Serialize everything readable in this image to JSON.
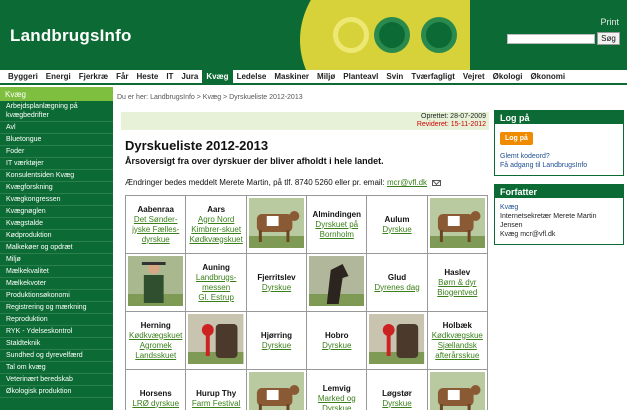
{
  "header": {
    "logo": "LandbrugsInfo",
    "print": "Print",
    "search_placeholder": "",
    "search_button": "Søg"
  },
  "topnav": [
    "Byggeri",
    "Energi",
    "Fjerkræ",
    "Får",
    "Heste",
    "IT",
    "Jura",
    "Kvæg",
    "Ledelse",
    "Maskiner",
    "Miljø",
    "Planteavl",
    "Svin",
    "Tværfagligt",
    "Vejret",
    "Økologi",
    "Økonomi"
  ],
  "topnav_active": "Kvæg",
  "sidebar": {
    "head": "Kvæg",
    "items": [
      "Arbejdsplanlægning på kvægbedrifter",
      "Avl",
      "Bluetongue",
      "Foder",
      "IT værktøjer",
      "Konsulentsiden Kvæg",
      "Kvægforskning",
      "Kvægkongressen",
      "Kvægnøglen",
      "Kvægstalde",
      "Kødproduktion",
      "Malkekøer og opdræt",
      "Miljø",
      "Mælkekvalitet",
      "Mælkekvoter",
      "Produktionsøkonomi",
      "Registrering og mærkning",
      "Reproduktion",
      "RYK - Ydelseskontrol",
      "Staldteknik",
      "Sundhed og dyrevelfærd",
      "Tal om kvæg",
      "Veterinært beredskab",
      "Økologisk produktion"
    ]
  },
  "main": {
    "breadcrumb": "Du er her: LandbrugsInfo > Kvæg > Dyrskueliste 2012-2013",
    "created": "Oprettet: 28-07-2009",
    "revised": "Revideret: 15-11-2012",
    "title": "Dyrskueliste 2012-2013",
    "subtitle": "Årsoversigt fra over dyrskuer der bliver afholdt i hele landet.",
    "changes_text": "Ændringer bedes meddelt Merete Martin, på tlf. 8740 5260 eller pr. email:",
    "changes_email": "mcr@vfl.dk"
  },
  "grid": [
    [
      {
        "city": "Aabenraa",
        "links": [
          "Det Sønder-jyske Fælles-dyrskue"
        ]
      },
      {
        "city": "Aars",
        "links": [
          "Agro Nord",
          "Kimbrer-skuet",
          "Kødkvægskuet"
        ]
      },
      {
        "photo": "cow-photo"
      },
      {
        "city": "Almindingen",
        "links": [
          "Dyrskuet på Bornholm"
        ]
      },
      {
        "city": "Aulum",
        "links": [
          "Dyrskue"
        ]
      },
      {
        "photo": "cow-photo"
      }
    ],
    [
      {
        "photo": "man-photo"
      },
      {
        "city": "Auning",
        "links": [
          "Landbrugs-messen",
          "Gl. Estrup"
        ]
      },
      {
        "city": "Fjerritslev",
        "links": [
          "Dyrskue"
        ]
      },
      {
        "photo": "horse-photo"
      },
      {
        "city": "Glud",
        "links": [
          "Dyrenes dag"
        ]
      },
      {
        "city": "Haslev",
        "links": [
          "Børn & dyr",
          "Biogentved"
        ]
      }
    ],
    [
      {
        "city": "Herning",
        "links": [
          "Kødkvægskuet",
          "Agromek",
          "Landsskuet"
        ]
      },
      {
        "photo": "rosette-photo"
      },
      {
        "city": "Hjørring",
        "links": [
          "Dyrskue"
        ]
      },
      {
        "city": "Hobro",
        "links": [
          "Dyrskue"
        ]
      },
      {
        "photo": "rosette-photo"
      },
      {
        "city": "Holbæk",
        "links": [
          "Kødkvægskue",
          "Sjællandsk afterårsskue"
        ]
      }
    ],
    [
      {
        "city": "Horsens",
        "links": [
          "LRØ dyrskue"
        ]
      },
      {
        "city": "Hurup Thy",
        "links": [
          "Farm Festival"
        ]
      },
      {
        "photo": "cow-photo"
      },
      {
        "city": "Lemvig",
        "links": [
          "Marked og Dyrskue"
        ]
      },
      {
        "city": "Løgstør",
        "links": [
          "Dyrskue"
        ]
      },
      {
        "photo": "cow-photo"
      }
    ]
  ],
  "login_box": {
    "title": "Log på",
    "button": "Log på",
    "forgot": "Glemt kodeord?",
    "access": "Få adgang til LandbrugsInfo"
  },
  "author_box": {
    "title": "Forfatter",
    "section": "Kvæg",
    "role": "Internetsekretær Merete Martin Jensen",
    "contact": "Kvæg mcr@vfl.dk"
  },
  "colors": {
    "brand_green": "#0c6b34",
    "accent_yellow": "#d8d23a",
    "light_green": "#7fbf3f",
    "link_green": "#3a7f1a",
    "login_orange": "#f08a00"
  }
}
